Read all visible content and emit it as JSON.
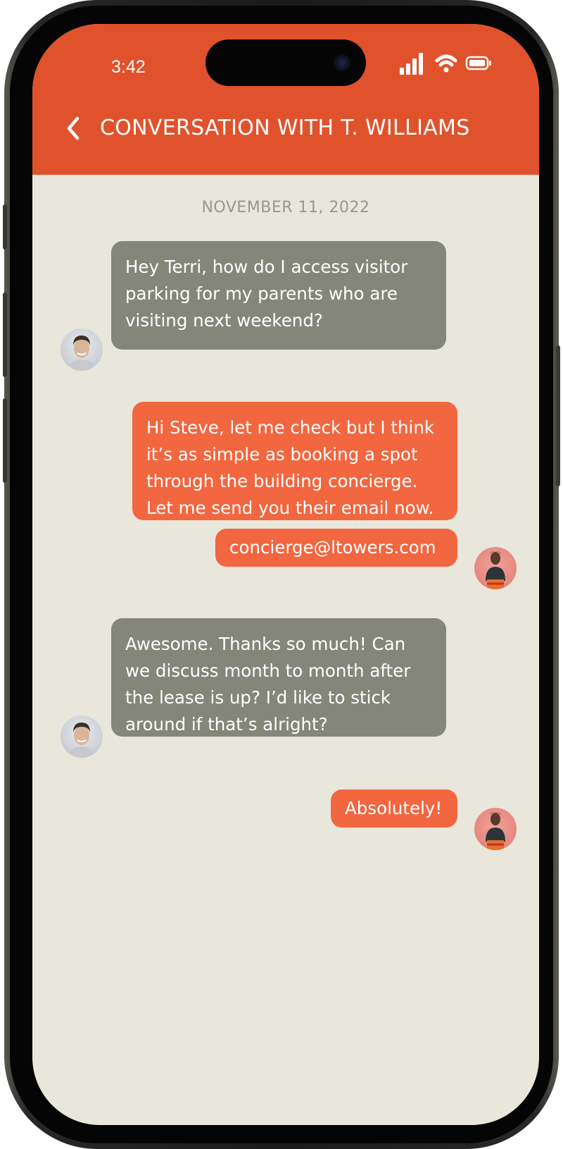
{
  "status_bar": {
    "time": "3:42"
  },
  "header": {
    "title": "CONVERSATION WITH T. WILLIAMS",
    "back_icon": "chevron-left-icon",
    "background_color": "#e0522c"
  },
  "conversation": {
    "date": "NOVEMBER 11, 2022",
    "messages": [
      {
        "sender": "Steve",
        "text": "Hey Terri, how do I access visitor parking for my parents who are visiting next weekend?"
      },
      {
        "sender": "Terri",
        "text": "Hi Steve, let me check but I think it’s as simple as booking a spot through the building concierge. Let me send you their email now."
      },
      {
        "sender": "Terri",
        "text": "concierge@ltowers.com"
      },
      {
        "sender": "Steve",
        "text": "Awesome. Thanks so much! Can we discuss month to month after the lease is up? I’d like to stick around if that’s alright?"
      },
      {
        "sender": "Terri",
        "text": "Absolutely!"
      }
    ]
  },
  "colors": {
    "incoming_bubble": "#85867a",
    "outgoing_bubble": "#f26640",
    "background": "#e9e6dc"
  }
}
